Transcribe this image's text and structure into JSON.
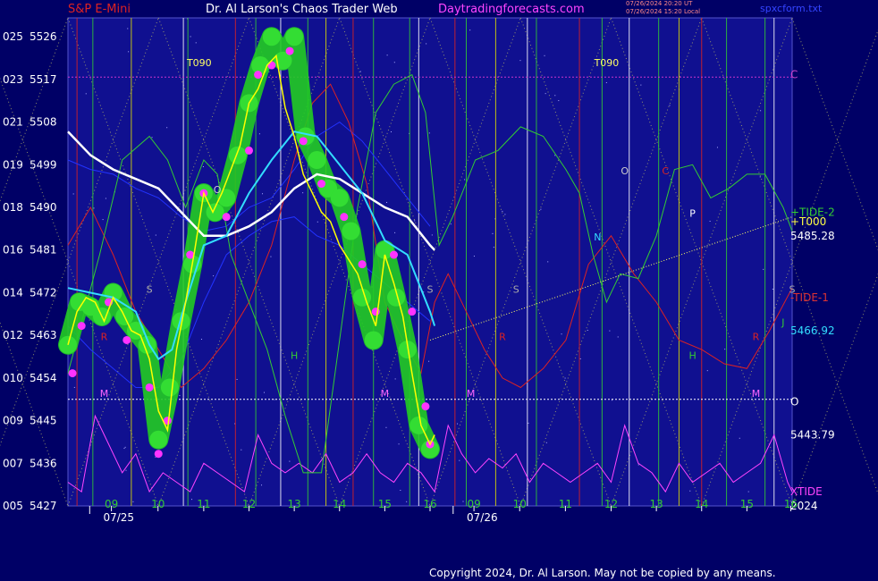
{
  "header": {
    "left": "S&P E-Mini",
    "center": "Dr. Al Larson's Chaos Trader Web",
    "site": "Daytradingforecasts.com",
    "stamp1": "07/26/2024 20:20 UT",
    "stamp2": "07/26/2024 15:20 Local",
    "file": "spxcform.txt"
  },
  "copyright": "Copyright 2024, Dr. Al Larson. May not be copied by any means.",
  "colors": {
    "background": "#000066",
    "plot_background": "#101090",
    "price": "#ffff00",
    "price_halo": "#22cc22",
    "price_dots": "#ff33ff",
    "cyan_ma": "#33ddff",
    "white_ma": "#ffffff",
    "tide1": "#dd2222",
    "tide2": "#33cc33",
    "xtide": "#ff44ff",
    "blue_line": "#2233ff",
    "forecast_line": "#ffff66"
  },
  "chart_data": {
    "type": "line",
    "title": "S&P E-Mini",
    "ylim": [
      5427,
      5530
    ],
    "yticks": [
      {
        "left": "025",
        "right": "5526"
      },
      {
        "left": "023",
        "right": "5517"
      },
      {
        "left": "021",
        "right": "5508"
      },
      {
        "left": "019",
        "right": "5499"
      },
      {
        "left": "018",
        "right": "5490"
      },
      {
        "left": "016",
        "right": "5481"
      },
      {
        "left": "014",
        "right": "5472"
      },
      {
        "left": "012",
        "right": "5463"
      },
      {
        "left": "010",
        "right": "5454"
      },
      {
        "left": "009",
        "right": "5445"
      },
      {
        "left": "007",
        "right": "5436"
      },
      {
        "left": "005",
        "right": "5427"
      }
    ],
    "x_range": [
      8.0,
      24.0
    ],
    "hour_ticks": [
      {
        "t": 8.96,
        "label": "09"
      },
      {
        "t": 9.99,
        "label": "10"
      },
      {
        "t": 11.0,
        "label": "11"
      },
      {
        "t": 12.0,
        "label": "12"
      },
      {
        "t": 13.0,
        "label": "13"
      },
      {
        "t": 14.0,
        "label": "14"
      },
      {
        "t": 15.0,
        "label": "15"
      },
      {
        "t": 16.0,
        "label": "16"
      },
      {
        "t": 16.97,
        "label": "09"
      },
      {
        "t": 17.98,
        "label": "10"
      },
      {
        "t": 18.99,
        "label": "11"
      },
      {
        "t": 20.0,
        "label": "12"
      },
      {
        "t": 21.0,
        "label": "13"
      },
      {
        "t": 22.0,
        "label": "14"
      },
      {
        "t": 23.0,
        "label": "15"
      },
      {
        "t": 23.97,
        "label": "16"
      }
    ],
    "date_labels": [
      {
        "t": 8.78,
        "label": "07/25"
      },
      {
        "t": 16.81,
        "label": "07/26"
      }
    ],
    "price": {
      "name": "price",
      "x": [
        8.0,
        8.2,
        8.4,
        8.6,
        8.8,
        9.0,
        9.2,
        9.4,
        9.6,
        9.8,
        10.0,
        10.2,
        10.4,
        10.6,
        10.8,
        11.0,
        11.2,
        11.4,
        11.6,
        11.8,
        12.0,
        12.2,
        12.4,
        12.6,
        12.8,
        13.0,
        13.2,
        13.4,
        13.6,
        13.8,
        14.0,
        14.2,
        14.4,
        14.6,
        14.8,
        15.0,
        15.2,
        15.4,
        15.6,
        15.8,
        16.0,
        16.1
      ],
      "y": [
        5461,
        5468,
        5471,
        5470,
        5466,
        5471,
        5468,
        5464,
        5463,
        5458,
        5447,
        5443,
        5460,
        5470,
        5481,
        5493,
        5489,
        5493,
        5498,
        5503,
        5512,
        5515,
        5520,
        5522,
        5511,
        5505,
        5497,
        5493,
        5489,
        5487,
        5482,
        5479,
        5476,
        5470,
        5465,
        5480,
        5474,
        5467,
        5455,
        5444,
        5440,
        5442
      ]
    },
    "price_halo": {
      "x": [
        8.0,
        8.25,
        8.5,
        8.75,
        9.0,
        9.25,
        9.5,
        9.75,
        10.0,
        10.25,
        10.5,
        10.75,
        11.0,
        11.25,
        11.5,
        11.75,
        12.0,
        12.25,
        12.5,
        12.75,
        13.0,
        13.25,
        13.5,
        13.75,
        14.0,
        14.25,
        14.5,
        14.75,
        15.0,
        15.25,
        15.5,
        15.75,
        16.0
      ],
      "y": [
        5461,
        5470,
        5469,
        5467,
        5472,
        5467,
        5464,
        5461,
        5441,
        5452,
        5466,
        5478,
        5493,
        5489,
        5492,
        5501,
        5512,
        5520,
        5526,
        5521,
        5526,
        5505,
        5500,
        5494,
        5492,
        5485,
        5471,
        5462,
        5481,
        5471,
        5460,
        5444,
        5439
      ]
    },
    "price_dots": {
      "x": [
        8.1,
        8.3,
        8.9,
        9.3,
        9.8,
        10.0,
        10.2,
        10.7,
        11.0,
        11.5,
        12.0,
        12.2,
        12.5,
        12.9,
        13.2,
        13.6,
        14.1,
        14.5,
        14.8,
        15.2,
        15.6,
        15.9,
        16.0
      ],
      "y": [
        5455,
        5465,
        5470,
        5462,
        5452,
        5438,
        5445,
        5480,
        5493,
        5488,
        5502,
        5518,
        5520,
        5523,
        5504,
        5495,
        5488,
        5478,
        5468,
        5480,
        5468,
        5448,
        5440
      ]
    },
    "series": [
      {
        "name": "TIDE-2",
        "x": [
          8,
          8.7,
          9.2,
          9.8,
          10.2,
          10.6,
          11.0,
          11.3,
          11.6,
          12.0,
          12.4,
          12.8,
          13.2,
          13.6,
          14.0,
          14.4,
          14.8,
          15.2,
          15.6,
          15.9,
          16.2,
          16.5,
          17.0,
          17.5,
          18.0,
          18.5,
          19.0,
          19.3,
          19.6,
          19.9,
          20.2,
          20.6,
          21.0,
          21.4,
          21.8,
          22.2,
          22.6,
          23.0,
          23.4,
          23.8,
          24.0
        ],
        "y": [
          5455,
          5480,
          5500,
          5505,
          5500,
          5490,
          5500,
          5497,
          5480,
          5470,
          5460,
          5446,
          5434,
          5434,
          5462,
          5490,
          5510,
          5516,
          5518,
          5510,
          5482,
          5488,
          5500,
          5502,
          5507,
          5505,
          5498,
          5493,
          5480,
          5470,
          5476,
          5475,
          5484,
          5498,
          5499,
          5492,
          5494,
          5497,
          5497,
          5490,
          5485
        ]
      },
      {
        "name": "-TIDE-1",
        "x": [
          8,
          8.5,
          9.0,
          9.5,
          10.0,
          10.5,
          11.0,
          11.5,
          12.0,
          12.5,
          13.0,
          13.4,
          13.8,
          14.2,
          14.6,
          15.0,
          15.4,
          15.8,
          16.1,
          16.4,
          16.8,
          17.2,
          17.6,
          18.0,
          18.5,
          19.0,
          19.5,
          20.0,
          20.5,
          21.0,
          21.5,
          22.0,
          22.5,
          23.0,
          23.5,
          24.0
        ],
        "y": [
          5482,
          5490,
          5480,
          5468,
          5460,
          5452,
          5456,
          5462,
          5470,
          5482,
          5500,
          5512,
          5516,
          5508,
          5495,
          5470,
          5462,
          5455,
          5470,
          5476,
          5468,
          5460,
          5454,
          5452,
          5456,
          5462,
          5478,
          5484,
          5476,
          5470,
          5462,
          5460,
          5457,
          5456,
          5464,
          5473
        ]
      },
      {
        "name": "cyan",
        "x": [
          8,
          8.5,
          9.0,
          9.5,
          9.8,
          10.0,
          10.3,
          10.6,
          11.0,
          11.5,
          12.0,
          12.5,
          13.0,
          13.5,
          14.0,
          14.5,
          15.0,
          15.5,
          16.0,
          16.1
        ],
        "y": [
          5473,
          5472,
          5471,
          5468,
          5461,
          5458,
          5460,
          5470,
          5482,
          5484,
          5493,
          5500,
          5506,
          5505,
          5499,
          5493,
          5483,
          5480,
          5468,
          5465
        ]
      },
      {
        "name": "white",
        "x": [
          8,
          8.5,
          9.0,
          9.5,
          10.0,
          10.5,
          11.0,
          11.5,
          12.0,
          12.5,
          13.0,
          13.5,
          14.0,
          14.5,
          15.0,
          15.5,
          16.0,
          16.1
        ],
        "y": [
          5506,
          5501,
          5498,
          5496,
          5494,
          5489,
          5484,
          5484,
          5486,
          5489,
          5494,
          5497,
          5496,
          5493,
          5490,
          5488,
          5482,
          5481
        ]
      },
      {
        "name": "blue",
        "x": [
          8,
          8.5,
          9.0,
          9.5,
          10.0,
          10.5,
          11.0,
          11.5,
          12.0,
          12.5,
          13.0,
          13.5,
          14.0,
          14.5,
          15.0,
          15.5,
          16.0
        ],
        "y": [
          5500,
          5498,
          5497,
          5494,
          5492,
          5488,
          5485,
          5486,
          5490,
          5492,
          5498,
          5505,
          5508,
          5504,
          5498,
          5492,
          5486
        ]
      },
      {
        "name": "blue2",
        "x": [
          8,
          8.5,
          9.0,
          9.5,
          10.0,
          10.5,
          11.0,
          11.5,
          12.0,
          12.5,
          13.0,
          13.5,
          14.0,
          14.5,
          15.0,
          15.5,
          16.0
        ],
        "y": [
          5465,
          5460,
          5456,
          5452,
          5452,
          5458,
          5470,
          5480,
          5484,
          5487,
          5488,
          5484,
          5482,
          5478,
          5474,
          5470,
          5466
        ]
      },
      {
        "name": "XTIDE",
        "x": [
          8,
          8.3,
          8.6,
          8.9,
          9.2,
          9.5,
          9.8,
          10.1,
          10.4,
          10.7,
          11.0,
          11.3,
          11.6,
          11.9,
          12.2,
          12.5,
          12.8,
          13.1,
          13.4,
          13.7,
          14.0,
          14.3,
          14.6,
          14.9,
          15.2,
          15.5,
          15.8,
          16.1,
          16.4,
          16.7,
          17.0,
          17.3,
          17.6,
          17.9,
          18.2,
          18.5,
          18.8,
          19.1,
          19.4,
          19.7,
          20.0,
          20.3,
          20.6,
          20.9,
          21.2,
          21.5,
          21.8,
          22.1,
          22.4,
          22.7,
          23.0,
          23.3,
          23.6,
          23.9,
          24.0
        ],
        "y": [
          5432,
          5430,
          5446,
          5440,
          5434,
          5438,
          5430,
          5434,
          5432,
          5430,
          5436,
          5434,
          5432,
          5430,
          5442,
          5436,
          5434,
          5436,
          5434,
          5438,
          5432,
          5434,
          5438,
          5434,
          5432,
          5436,
          5434,
          5430,
          5444,
          5438,
          5434,
          5437,
          5435,
          5438,
          5432,
          5436,
          5434,
          5432,
          5434,
          5436,
          5432,
          5444,
          5436,
          5434,
          5430,
          5436,
          5432,
          5434,
          5436,
          5432,
          5434,
          5436,
          5442,
          5432,
          5430
        ]
      }
    ],
    "forecast_line": {
      "x": [
        16.0,
        24.0
      ],
      "y": [
        5462,
        5488
      ]
    },
    "hlines": [
      {
        "y": 5517.5,
        "color": "#cc33cc"
      },
      {
        "y": 5449.5,
        "color": "#ffffff"
      }
    ],
    "grid": true,
    "letter_labels": [
      {
        "t": 8.8,
        "y": 5450,
        "text": "M",
        "color": "#ff66ff"
      },
      {
        "t": 9.8,
        "y": 5472,
        "text": "S",
        "color": "#aaaaaa"
      },
      {
        "t": 8.8,
        "y": 5462,
        "text": "R",
        "color": "#dd2222"
      },
      {
        "t": 11.3,
        "y": 5493,
        "text": "O",
        "color": "#cccccc"
      },
      {
        "t": 13.0,
        "y": 5458,
        "text": "H",
        "color": "#33cc33"
      },
      {
        "t": 15.0,
        "y": 5450,
        "text": "M",
        "color": "#ff66ff"
      },
      {
        "t": 16.0,
        "y": 5472,
        "text": "S",
        "color": "#aaaaaa"
      },
      {
        "t": 17.9,
        "y": 5472,
        "text": "S",
        "color": "#aaaaaa"
      },
      {
        "t": 16.9,
        "y": 5450,
        "text": "M",
        "color": "#ff66ff"
      },
      {
        "t": 17.6,
        "y": 5462,
        "text": "R",
        "color": "#dd2222"
      },
      {
        "t": 19.7,
        "y": 5483,
        "text": "N",
        "color": "#33ddff"
      },
      {
        "t": 20.3,
        "y": 5497,
        "text": "O",
        "color": "#cccccc"
      },
      {
        "t": 21.2,
        "y": 5497,
        "text": "C",
        "color": "#dd2222"
      },
      {
        "t": 21.8,
        "y": 5488,
        "text": "P",
        "color": "#ffffff"
      },
      {
        "t": 21.8,
        "y": 5458,
        "text": "H",
        "color": "#33cc33"
      },
      {
        "t": 23.2,
        "y": 5450,
        "text": "M",
        "color": "#ff66ff"
      },
      {
        "t": 23.2,
        "y": 5462,
        "text": "R",
        "color": "#dd2222"
      },
      {
        "t": 23.8,
        "y": 5465,
        "text": "J",
        "color": "#33cc33"
      },
      {
        "t": 24.0,
        "y": 5472,
        "text": "S",
        "color": "#aaaaaa"
      }
    ],
    "top_labels": [
      {
        "t": 10.9,
        "text": "T090"
      },
      {
        "t": 19.9,
        "text": "T090"
      }
    ],
    "right_labels": [
      {
        "y": 5518,
        "text": "C",
        "color": "#cc44cc"
      },
      {
        "y": 5489,
        "text": "+TIDE-2",
        "color": "#33cc33"
      },
      {
        "y": 5487,
        "text": "+T000",
        "color": "#ffff44"
      },
      {
        "y": 5484,
        "text": "5485.28",
        "color": "#ffffff"
      },
      {
        "y": 5471,
        "text": "-TIDE-1",
        "color": "#dd3333"
      },
      {
        "y": 5464,
        "text": "5466.92",
        "color": "#33ddff"
      },
      {
        "y": 5449,
        "text": "O",
        "color": "#ffffff"
      },
      {
        "y": 5442,
        "text": "5443.79",
        "color": "#ffffff"
      },
      {
        "y": 5430,
        "text": "XTIDE",
        "color": "#ff44ff"
      },
      {
        "y": 5427,
        "text": "2024",
        "color": "#ffffff"
      }
    ],
    "vlines": [
      {
        "t": 8.2,
        "color": "#dd2222"
      },
      {
        "t": 8.55,
        "color": "#33cc33"
      },
      {
        "t": 9.4,
        "color": "#dddd00"
      },
      {
        "t": 10.55,
        "color": "#ffffff"
      },
      {
        "t": 10.65,
        "color": "#33cc33"
      },
      {
        "t": 11.7,
        "color": "#dd2222"
      },
      {
        "t": 12.15,
        "color": "#33cc33"
      },
      {
        "t": 12.7,
        "color": "#ffffff"
      },
      {
        "t": 13.3,
        "color": "#33cc33"
      },
      {
        "t": 13.7,
        "color": "#dddd00"
      },
      {
        "t": 14.3,
        "color": "#dd2222"
      },
      {
        "t": 14.75,
        "color": "#33cc33"
      },
      {
        "t": 15.55,
        "color": "#33cc33"
      },
      {
        "t": 15.75,
        "color": "#ffffff"
      },
      {
        "t": 16.55,
        "color": "#dd2222"
      },
      {
        "t": 16.8,
        "color": "#33cc33"
      },
      {
        "t": 17.45,
        "color": "#dddd00"
      },
      {
        "t": 18.15,
        "color": "#ffffff"
      },
      {
        "t": 18.35,
        "color": "#33cc33"
      },
      {
        "t": 19.3,
        "color": "#dd2222"
      },
      {
        "t": 19.8,
        "color": "#33cc33"
      },
      {
        "t": 20.4,
        "color": "#ffffff"
      },
      {
        "t": 21.05,
        "color": "#33cc33"
      },
      {
        "t": 21.5,
        "color": "#dddd00"
      },
      {
        "t": 22.0,
        "color": "#dd2222"
      },
      {
        "t": 22.55,
        "color": "#33cc33"
      },
      {
        "t": 23.4,
        "color": "#33cc33"
      },
      {
        "t": 23.6,
        "color": "#ffffff"
      }
    ]
  }
}
